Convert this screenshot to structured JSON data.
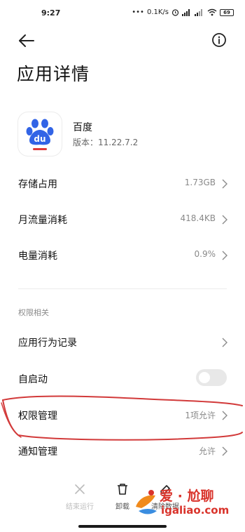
{
  "status_bar": {
    "time": "9:27",
    "net_speed": "0.1K/s",
    "battery": "69"
  },
  "header": {
    "title": "应用详情"
  },
  "app": {
    "name": "百度",
    "version": "版本：11.22.7.2",
    "icon_text": "du",
    "brand_color": "#3264e6",
    "accent_color": "#e03a3a"
  },
  "rows": {
    "storage": {
      "label": "存储占用",
      "value": "1.73GB"
    },
    "data": {
      "label": "月流量消耗",
      "value": "418.4KB"
    },
    "battery": {
      "label": "电量消耗",
      "value": "0.9%"
    }
  },
  "permissions": {
    "section_title": "权限相关",
    "behavior": {
      "label": "应用行为记录"
    },
    "autostart": {
      "label": "自启动",
      "enabled": false
    },
    "permission_mgmt": {
      "label": "权限管理",
      "value": "1项允许"
    },
    "notification_mgmt": {
      "label": "通知管理",
      "value": "允许"
    }
  },
  "annotation_color": "#d23a3a",
  "bottom_actions": {
    "stop": {
      "label": "结束运行",
      "icon": "close-icon"
    },
    "uninstall": {
      "label": "卸载",
      "icon": "trash-icon"
    },
    "clear": {
      "label": "清除数据",
      "icon": "eraser-icon"
    }
  },
  "watermark": {
    "text": "爱 · 尬聊",
    "url": "igaliao.com"
  }
}
